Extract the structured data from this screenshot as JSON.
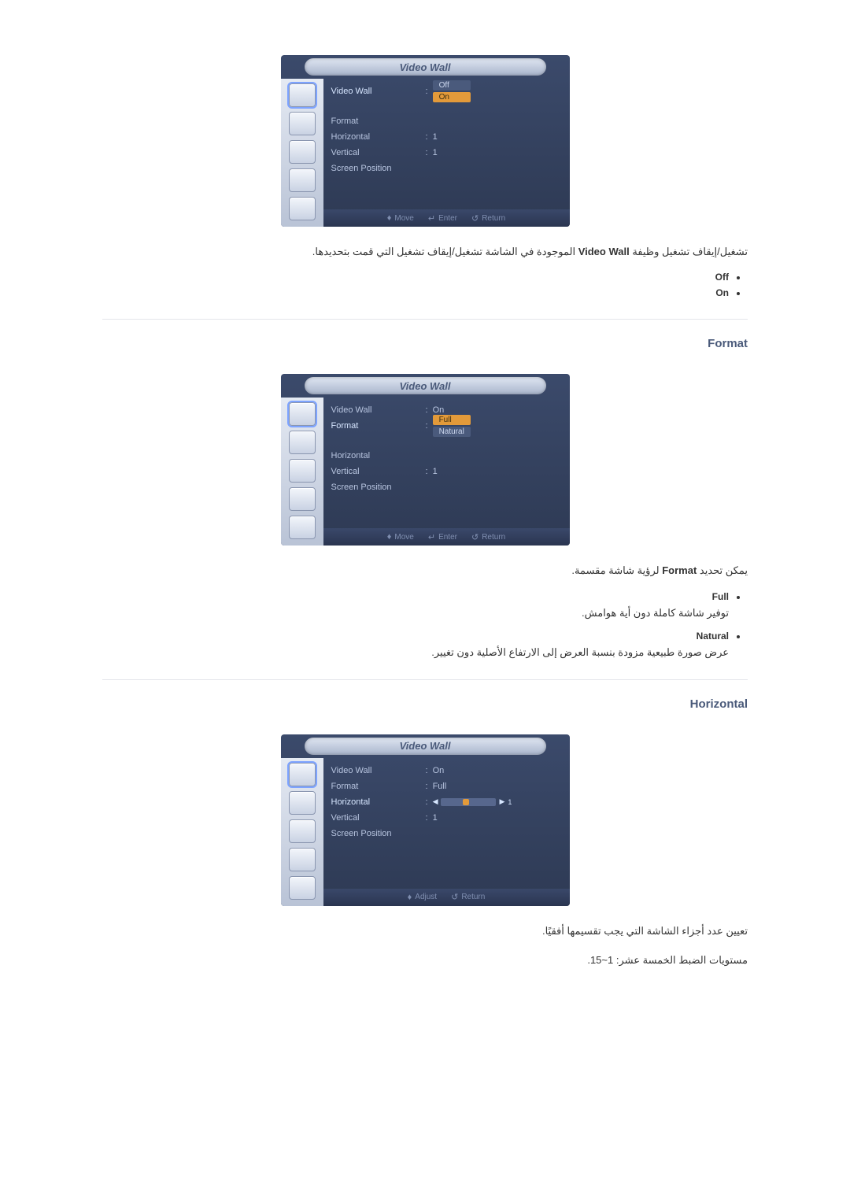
{
  "osd_title": "Video Wall",
  "menu_labels": {
    "video_wall": "Video Wall",
    "format": "Format",
    "horizontal": "Horizontal",
    "vertical": "Vertical",
    "screen_position": "Screen Position"
  },
  "screenshot1": {
    "video_wall_options": [
      "Off",
      "On"
    ],
    "video_wall_highlight_index": 1,
    "horizontal_value": "1",
    "vertical_value": "1",
    "footer": {
      "move": "Move",
      "enter": "Enter",
      "return": "Return"
    }
  },
  "screenshot2": {
    "video_wall_value": "On",
    "format_options": [
      "Full",
      "Natural"
    ],
    "format_highlight_index": 0,
    "vertical_value": "1",
    "footer": {
      "move": "Move",
      "enter": "Enter",
      "return": "Return"
    }
  },
  "screenshot3": {
    "video_wall_value": "On",
    "format_value": "Full",
    "horizontal_slider_value": "1",
    "vertical_value": "1",
    "footer": {
      "adjust": "Adjust",
      "return": "Return"
    }
  },
  "text": {
    "para1_pre": "تشغيل/إيقاف تشغيل وظيفة ",
    "para1_bold": "Video Wall",
    "para1_post": " الموجودة في الشاشة تشغيل/إيقاف تشغيل التي قمت بتحديدها.",
    "off": "Off",
    "on": "On",
    "heading_format": "Format",
    "para2_pre": "يمكن تحديد ",
    "para2_bold": "Format",
    "para2_post": " لرؤية شاشة مقسمة.",
    "full": "Full",
    "full_desc": "توفير شاشة كاملة دون أية هوامش.",
    "natural": "Natural",
    "natural_desc": "عرض صورة طبيعية مزودة بنسبة العرض إلى الارتفاع الأصلية دون تغيير.",
    "heading_horizontal": "Horizontal",
    "para3": "تعيين عدد أجزاء الشاشة التي يجب تقسيمها أفقيًا.",
    "para4": "مستويات الضبط الخمسة عشر: 1~15."
  }
}
